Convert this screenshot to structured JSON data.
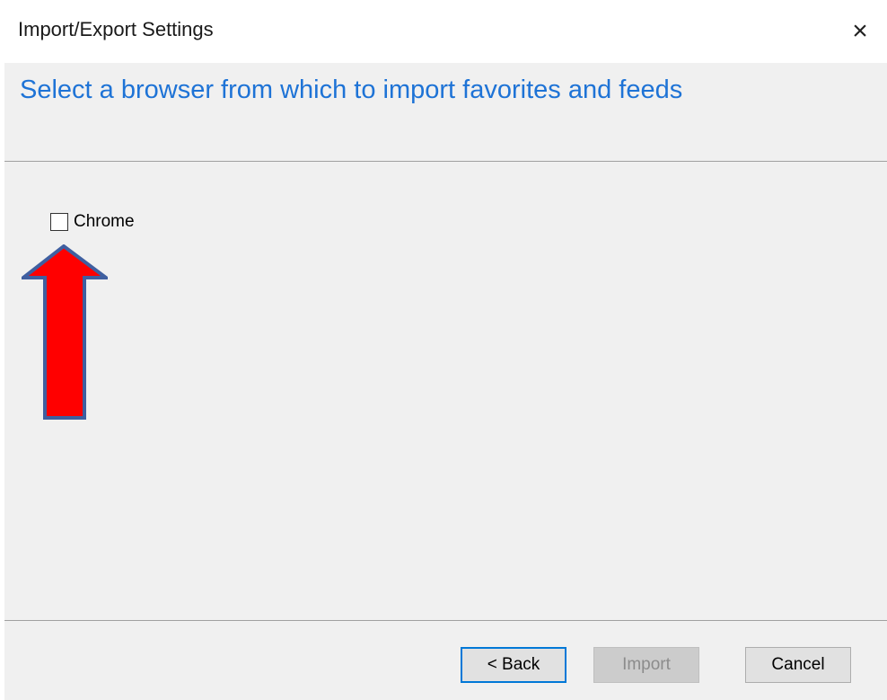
{
  "window": {
    "title": "Import/Export Settings",
    "close_label": "×"
  },
  "page": {
    "heading": "Select a browser from which to import favorites and feeds"
  },
  "browsers": [
    {
      "label": "Chrome",
      "checked": false
    }
  ],
  "annotation": {
    "color": "#ff0000",
    "outline": "#3f5fa0"
  },
  "buttons": {
    "back": "< Back",
    "import": "Import",
    "cancel": "Cancel"
  }
}
